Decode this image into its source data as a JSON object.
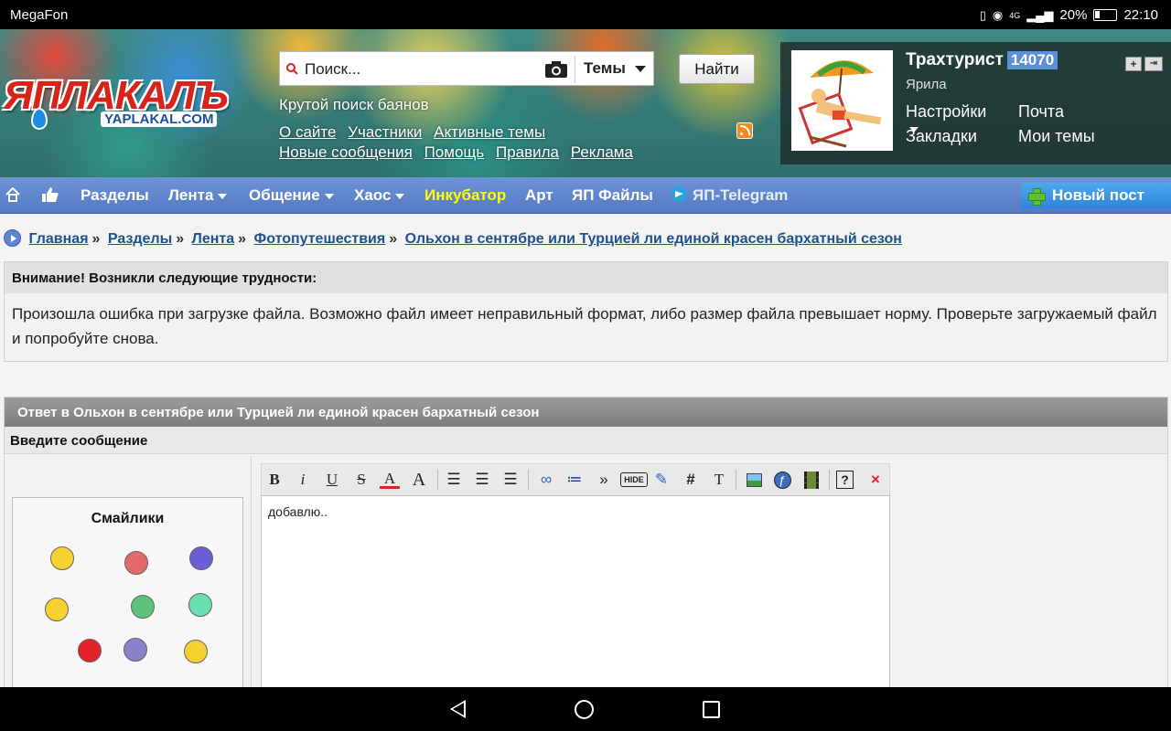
{
  "status_bar": {
    "carrier": "MegaFon",
    "network": "4G",
    "battery": "20%",
    "time": "22:10"
  },
  "header": {
    "logo_text": "ЯПЛАКАЛЪ",
    "logo_sub": "YAPLAKAL.COM",
    "search": {
      "placeholder": "Поиск...",
      "scope_selected": "Темы",
      "button": "Найти"
    },
    "tagline": "Крутой поиск баянов",
    "links": [
      "О сайте",
      "Участники",
      "Активные темы",
      "Новые сообщения",
      "Помощь",
      "Правила",
      "Реклама"
    ]
  },
  "user": {
    "name": "Трахтурист",
    "reputation": "14070",
    "rank": "Ярила",
    "links": {
      "settings": "Настройки",
      "mail": "Почта",
      "bookmarks": "Закладки",
      "my_topics": "Мои темы"
    }
  },
  "nav": {
    "items": [
      "Разделы",
      "Лента",
      "Общение",
      "Хаос",
      "Инкубатор",
      "Арт",
      "ЯП Файлы",
      "ЯП-Telegram"
    ],
    "new_post": "Новый пост",
    "highlight_color": "#ffff00"
  },
  "breadcrumb": {
    "items": [
      "Главная",
      "Разделы",
      "Лента",
      "Фотопутешествия"
    ],
    "current": "Ольхон в сентябре или Турцией ли единой красен бархатный сезон",
    "separator": "»"
  },
  "error": {
    "title": "Внимание! Возникли следующие трудности:",
    "message": "Произошла ошибка при загрузке файла. Возможно файл имеет неправильный формат, либо размер файла превышает норму. Проверьте загружаемый файл и попробуйте снова."
  },
  "reply": {
    "title": "Ответ в Ольхон в сентябре или Турцией ли единой красен бархатный сезон",
    "subtitle": "Введите сообщение",
    "smilies_title": "Смайлики",
    "editor_text": "добавлю..",
    "toolbar": [
      "B",
      "i",
      "U",
      "S",
      "A",
      "A",
      "align-left",
      "align-center",
      "align-right",
      "link",
      "list",
      "»",
      "HIDE",
      "edit",
      "#",
      "T",
      "image",
      "flash",
      "video",
      "help",
      "×"
    ]
  }
}
